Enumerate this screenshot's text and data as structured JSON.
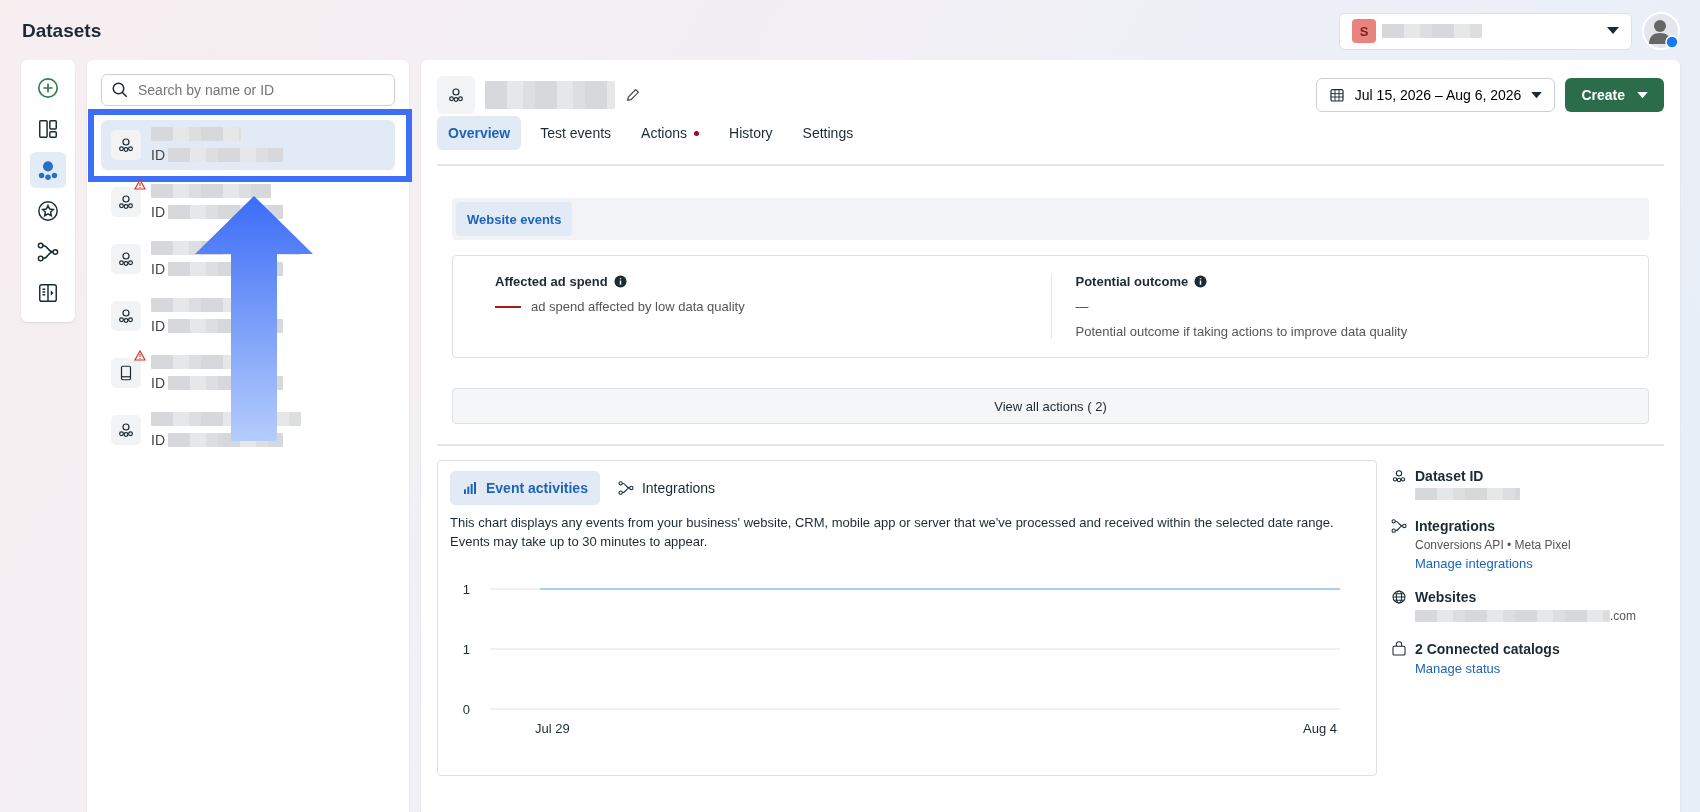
{
  "page": {
    "title": "Datasets"
  },
  "account_selector": {
    "initial": "S"
  },
  "rail": [
    {
      "kind": "add",
      "selected": false
    },
    {
      "kind": "layout",
      "selected": false
    },
    {
      "kind": "dataset",
      "selected": true
    },
    {
      "kind": "star",
      "selected": false
    },
    {
      "kind": "integrations",
      "selected": false
    },
    {
      "kind": "panel",
      "selected": false
    }
  ],
  "dataset_list": {
    "search": {
      "placeholder": "Search by name or ID"
    },
    "items": [
      {
        "kind": "dataset",
        "id_label": "ID",
        "warning": false,
        "selected": true
      },
      {
        "kind": "dataset",
        "id_label": "ID",
        "warning": true,
        "selected": false
      },
      {
        "kind": "dataset",
        "id_label": "ID",
        "warning": false,
        "selected": false
      },
      {
        "kind": "dataset",
        "id_label": "ID",
        "warning": false,
        "selected": false
      },
      {
        "kind": "device",
        "id_label": "ID",
        "warning": true,
        "selected": false
      },
      {
        "kind": "dataset",
        "id_label": "ID",
        "warning": false,
        "selected": false
      }
    ]
  },
  "detail": {
    "date_range": "Jul 15, 2026 – Aug 6, 2026",
    "create_button": "Create",
    "tabs": [
      {
        "label": "Overview",
        "selected": true,
        "alert": false
      },
      {
        "label": "Test events",
        "selected": false,
        "alert": false
      },
      {
        "label": "Actions",
        "selected": false,
        "alert": true
      },
      {
        "label": "History",
        "selected": false,
        "alert": false
      },
      {
        "label": "Settings",
        "selected": false,
        "alert": false
      }
    ],
    "event_source_tabs": [
      {
        "label": "Website events",
        "selected": true
      }
    ],
    "metrics": [
      {
        "title": "Affected ad spend",
        "kind": "negative",
        "description": "ad spend affected by low data quality"
      },
      {
        "title": "Potential outcome",
        "value": "—",
        "kind": "plain",
        "description": "Potential outcome if taking actions to improve data quality"
      }
    ],
    "view_actions_button": "View all actions ( 2)",
    "activity": {
      "tabs": [
        {
          "label": "Event activities",
          "kind": "bars",
          "selected": true
        },
        {
          "label": "Integrations",
          "kind": "integrations",
          "selected": false
        }
      ],
      "description": "This chart displays any events from your business' website, CRM, mobile app or server that we've processed and received within the selected date range. Events may take up to 30 minutes to appear.",
      "chart": {
        "y_labels": [
          "1",
          "1",
          "0"
        ],
        "x_labels": [
          "Jul 29",
          "Aug 4"
        ]
      }
    },
    "info": [
      {
        "kind": "dataset",
        "title": "Dataset ID"
      },
      {
        "kind": "integrations",
        "title": "Integrations",
        "subtitle": "Conversions API • Meta Pixel",
        "link": "Manage integrations"
      },
      {
        "kind": "globe",
        "title": "Websites",
        "suffix": ".com"
      },
      {
        "kind": "bag",
        "title": "2 Connected catalogs",
        "link": "Manage status"
      }
    ]
  }
}
